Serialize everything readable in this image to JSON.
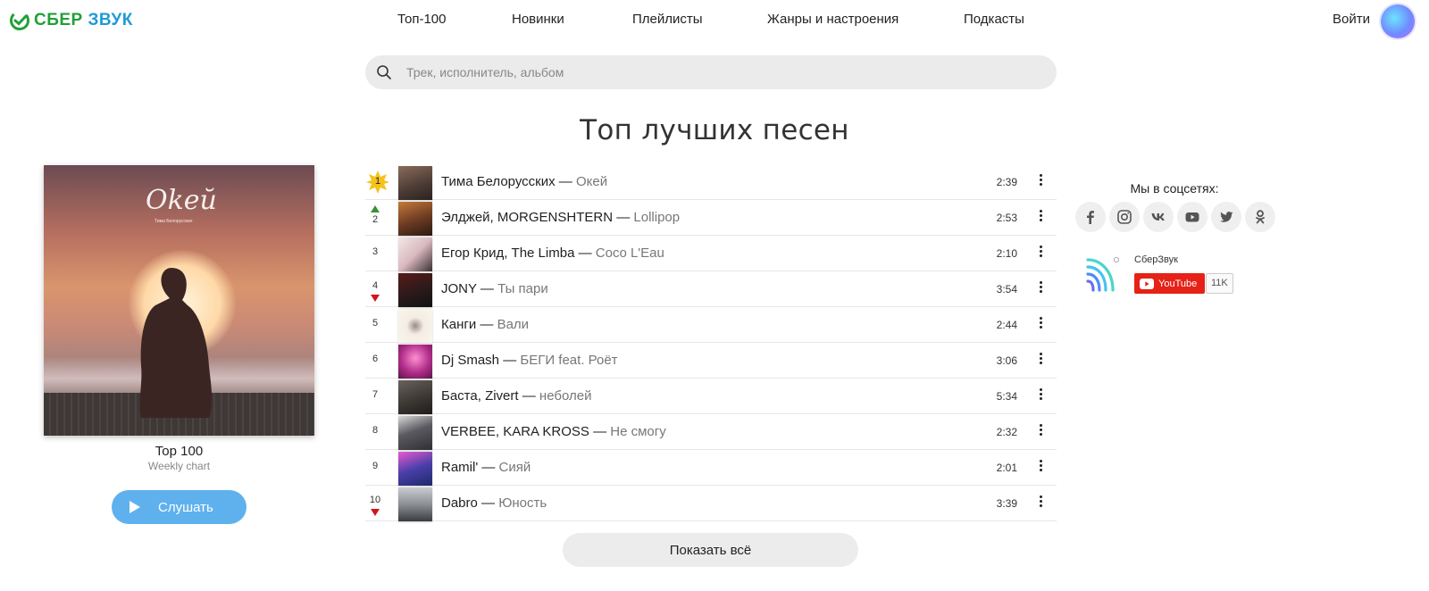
{
  "header": {
    "brand_sber": "СБЕР",
    "brand_zvuk": "ЗВУК",
    "nav": [
      "Топ-100",
      "Новинки",
      "Плейлисты",
      "Жанры и настроения",
      "Подкасты"
    ],
    "login_label": "Войти"
  },
  "search": {
    "placeholder": "Трек, исполнитель, альбом"
  },
  "main": {
    "title": "Топ лучших песен",
    "show_all_label": "Показать всё"
  },
  "album": {
    "cover_word": "Okeŭ",
    "cover_sub": "Тима Белорусских",
    "title": "Top 100",
    "subtitle": "Weekly chart",
    "listen_label": "Слушать"
  },
  "tracks": [
    {
      "num": "1",
      "artist": "Тима Белорусских",
      "title": "Окей",
      "duration": "2:39",
      "trend": "top"
    },
    {
      "num": "2",
      "artist": "Элджей, MORGENSHTERN",
      "title": "Lollipop",
      "duration": "2:53",
      "trend": "up"
    },
    {
      "num": "3",
      "artist": "Егор Крид, The Limba",
      "title": "Coco L'Eau",
      "duration": "2:10",
      "trend": "none"
    },
    {
      "num": "4",
      "artist": "JONY",
      "title": "Ты пари",
      "duration": "3:54",
      "trend": "down"
    },
    {
      "num": "5",
      "artist": "Канги",
      "title": "Вали",
      "duration": "2:44",
      "trend": "none"
    },
    {
      "num": "6",
      "artist": "Dj Smash",
      "title": "БЕГИ feat. Роёт",
      "duration": "3:06",
      "trend": "none"
    },
    {
      "num": "7",
      "artist": "Баста, Zivert",
      "title": "неболей",
      "duration": "5:34",
      "trend": "none"
    },
    {
      "num": "8",
      "artist": "VERBEE, KARA KROSS",
      "title": "Не смогу",
      "duration": "2:32",
      "trend": "none"
    },
    {
      "num": "9",
      "artist": "Ramil'",
      "title": "Сияй",
      "duration": "2:01",
      "trend": "none"
    },
    {
      "num": "10",
      "artist": "Dabro",
      "title": "Юность",
      "duration": "3:39",
      "trend": "down"
    }
  ],
  "social": {
    "title": "Мы в соцсетях:",
    "icons": [
      "facebook-icon",
      "instagram-icon",
      "vk-icon",
      "youtube-icon",
      "twitter-icon",
      "odnoklassniki-icon"
    ],
    "widget_name": "СберЗвук",
    "youtube_label": "YouTube",
    "subscriber_count": "11K"
  },
  "colors": {
    "brand_green": "#21a038",
    "brand_blue": "#1e9bd7",
    "listen_button": "#5fb1ee",
    "trend_up": "#3a8f3a",
    "trend_down": "#d0161b",
    "top_badge": "#f5c21b",
    "youtube_red": "#e62117"
  },
  "thumb_colors": [
    "#4a3a33",
    "#6b3a22",
    "#e9d9d9",
    "#3a2a2a",
    "#f3ece2",
    "#b02c8a",
    "#3c3834",
    "#2f2f33",
    "#4a3fa8",
    "#8b8f94"
  ]
}
